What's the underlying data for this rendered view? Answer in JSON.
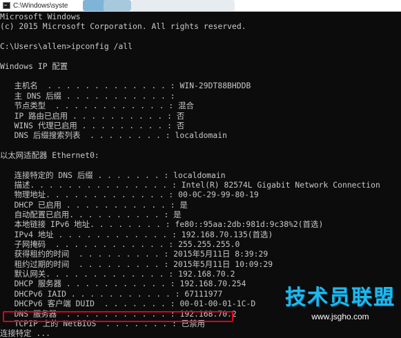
{
  "window": {
    "title": "C:\\Windows\\syste",
    "accent_color": "#e1001a"
  },
  "console_lines": [
    "Microsoft Windows",
    "(c) 2015 Microsoft Corporation. All rights reserved.",
    "",
    "C:\\Users\\allen>ipconfig /all",
    "",
    "Windows IP 配置",
    "",
    "   主机名  . . . . . . . . . . . . . : WIN-29DT88BHDDB",
    "   主 DNS 后缀 . . . . . . . . . . . :",
    "   节点类型  . . . . . . . . . . . . : 混合",
    "   IP 路由已启用 . . . . . . . . . . : 否",
    "   WINS 代理已启用 . . . . . . . . . : 否",
    "   DNS 后缀搜索列表  . . . . . . . . : localdomain",
    "",
    "以太网适配器 Ethernet0:",
    "",
    "   连接特定的 DNS 后缀 . . . . . . . : localdomain",
    "   描述. . . . . . . . . . . . . . . : Intel(R) 82574L Gigabit Network Connection",
    "   物理地址. . . . . . . . . . . . . : 00-0C-29-99-80-19",
    "   DHCP 已启用 . . . . . . . . . . . : 是",
    "   自动配置已启用. . . . . . . . . . : 是",
    "   本地链接 IPv6 地址. . . . . . . . : fe80::95aa:2db:981d:9c38%2(首选)",
    "   IPv4 地址 . . . . . . . . . . . . : 192.168.70.135(首选)",
    "   子网掩码  . . . . . . . . . . . . : 255.255.255.0",
    "   获得租约的时间  . . . . . . . . . : 2015年5月11日 8:39:29",
    "   租约过期的时间  . . . . . . . . . : 2015年5月11日 10:09:29",
    "   默认网关. . . . . . . . . . . . . : 192.168.70.2",
    "   DHCP 服务器 . . . . . . . . . . . : 192.168.70.254",
    "   DHCPv6 IAID . . . . . . . . . . . : 67111977",
    "   DHCPv6 客户端 DUID  . . . . . . . : 00-01-00-01-1C-D",
    "   DNS 服务器  . . . . . . . . . . . : 192.168.70.2",
    "   TCPIP 上的 NetBIOS  . . . . . . . : 已禁用",
    "连接特定 ..."
  ],
  "watermark": {
    "brand": "技术员联盟",
    "url": "www.jsgho.com"
  }
}
